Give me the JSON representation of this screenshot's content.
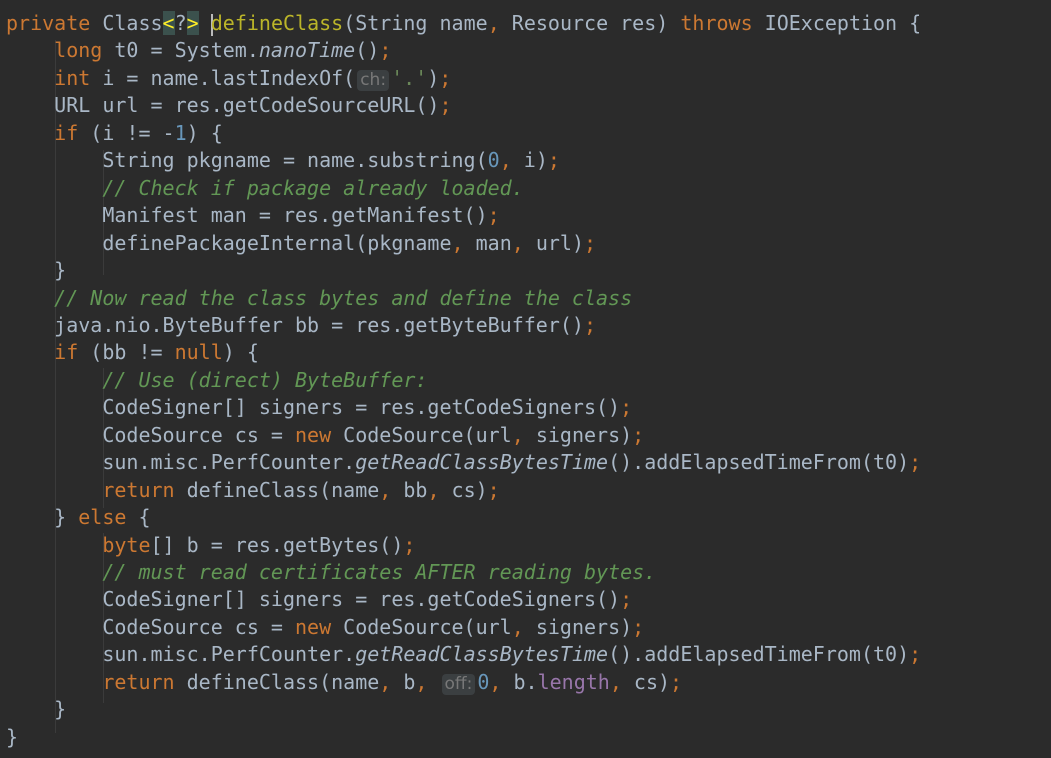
{
  "editor": {
    "language": "java",
    "colors": {
      "background": "#2b2b2b",
      "text": "#a9b7c6",
      "keyword": "#cc7832",
      "comment": "#629755",
      "number": "#6897bb",
      "string": "#6a8759",
      "field": "#9876aa",
      "hint_background": "#3b3f41"
    },
    "lines": [
      {
        "tokens": [
          {
            "t": "private",
            "c": "kw"
          },
          {
            "t": " Class"
          },
          {
            "t": "<",
            "c": "brm"
          },
          {
            "t": "?"
          },
          {
            "t": ">",
            "c": "brm"
          },
          {
            "t": " "
          },
          {
            "caret": true
          },
          {
            "t": "defineClass",
            "c": "ann"
          },
          {
            "t": "(String name"
          },
          {
            "t": ",",
            "c": "kw"
          },
          {
            "t": " Resource res) "
          },
          {
            "t": "throws",
            "c": "kw"
          },
          {
            "t": " IOException {"
          }
        ]
      },
      {
        "tokens": [
          {
            "t": "    "
          },
          {
            "t": "long",
            "c": "kw"
          },
          {
            "t": " t0 = System."
          },
          {
            "t": "nanoTime",
            "c": "it"
          },
          {
            "t": "()"
          },
          {
            "t": ";",
            "c": "kw"
          }
        ]
      },
      {
        "tokens": [
          {
            "t": "    "
          },
          {
            "t": "int",
            "c": "kw"
          },
          {
            "t": " i = name.lastIndexOf("
          },
          {
            "hint": "ch:"
          },
          {
            "t": "'.'",
            "c": "str"
          },
          {
            "t": ")"
          },
          {
            "t": ";",
            "c": "kw"
          }
        ]
      },
      {
        "tokens": [
          {
            "t": "    URL url = res.getCodeSourceURL()"
          },
          {
            "t": ";",
            "c": "kw"
          }
        ]
      },
      {
        "tokens": [
          {
            "t": "    "
          },
          {
            "t": "if",
            "c": "kw"
          },
          {
            "t": " (i != -"
          },
          {
            "t": "1",
            "c": "num"
          },
          {
            "t": ") {"
          }
        ]
      },
      {
        "tokens": [
          {
            "t": "        String pkgname = name.substring("
          },
          {
            "t": "0",
            "c": "num"
          },
          {
            "t": ",",
            "c": "kw"
          },
          {
            "t": " i)"
          },
          {
            "t": ";",
            "c": "kw"
          }
        ]
      },
      {
        "tokens": [
          {
            "t": "        "
          },
          {
            "t": "// Check if package already loaded.",
            "c": "cm"
          }
        ]
      },
      {
        "tokens": [
          {
            "t": "        Manifest man = res.getManifest()"
          },
          {
            "t": ";",
            "c": "kw"
          }
        ]
      },
      {
        "tokens": [
          {
            "t": "        definePackageInternal(pkgname"
          },
          {
            "t": ",",
            "c": "kw"
          },
          {
            "t": " man"
          },
          {
            "t": ",",
            "c": "kw"
          },
          {
            "t": " url)"
          },
          {
            "t": ";",
            "c": "kw"
          }
        ]
      },
      {
        "tokens": [
          {
            "t": "    }"
          }
        ]
      },
      {
        "tokens": [
          {
            "t": "    "
          },
          {
            "t": "// Now read the class bytes and define the class",
            "c": "cm"
          }
        ]
      },
      {
        "tokens": [
          {
            "t": "    java.nio.ByteBuffer bb = res.getByteBuffer()"
          },
          {
            "t": ";",
            "c": "kw"
          }
        ]
      },
      {
        "tokens": [
          {
            "t": "    "
          },
          {
            "t": "if",
            "c": "kw"
          },
          {
            "t": " (bb != "
          },
          {
            "t": "null",
            "c": "kw"
          },
          {
            "t": ") {"
          }
        ]
      },
      {
        "tokens": [
          {
            "t": "        "
          },
          {
            "t": "// Use (direct) ByteBuffer:",
            "c": "cm"
          }
        ]
      },
      {
        "tokens": [
          {
            "t": "        CodeSigner[] signers = res.getCodeSigners()"
          },
          {
            "t": ";",
            "c": "kw"
          }
        ]
      },
      {
        "tokens": [
          {
            "t": "        CodeSource cs = "
          },
          {
            "t": "new",
            "c": "kw"
          },
          {
            "t": " CodeSource(url"
          },
          {
            "t": ",",
            "c": "kw"
          },
          {
            "t": " signers)"
          },
          {
            "t": ";",
            "c": "kw"
          }
        ]
      },
      {
        "tokens": [
          {
            "t": "        sun.misc.PerfCounter."
          },
          {
            "t": "getReadClassBytesTime",
            "c": "it"
          },
          {
            "t": "().addElapsedTimeFrom(t0)"
          },
          {
            "t": ";",
            "c": "kw"
          }
        ]
      },
      {
        "tokens": [
          {
            "t": "        "
          },
          {
            "t": "return",
            "c": "kw"
          },
          {
            "t": " defineClass(name"
          },
          {
            "t": ",",
            "c": "kw"
          },
          {
            "t": " bb"
          },
          {
            "t": ",",
            "c": "kw"
          },
          {
            "t": " cs)"
          },
          {
            "t": ";",
            "c": "kw"
          }
        ]
      },
      {
        "tokens": [
          {
            "t": "    } "
          },
          {
            "t": "else",
            "c": "kw"
          },
          {
            "t": " {"
          }
        ]
      },
      {
        "tokens": [
          {
            "t": "        "
          },
          {
            "t": "byte",
            "c": "kw"
          },
          {
            "t": "[] b = res.getBytes()"
          },
          {
            "t": ";",
            "c": "kw"
          }
        ]
      },
      {
        "tokens": [
          {
            "t": "        "
          },
          {
            "t": "// must read certificates AFTER reading bytes.",
            "c": "cm"
          }
        ]
      },
      {
        "tokens": [
          {
            "t": "        CodeSigner[] signers = res.getCodeSigners()"
          },
          {
            "t": ";",
            "c": "kw"
          }
        ]
      },
      {
        "tokens": [
          {
            "t": "        CodeSource cs = "
          },
          {
            "t": "new",
            "c": "kw"
          },
          {
            "t": " CodeSource(url"
          },
          {
            "t": ",",
            "c": "kw"
          },
          {
            "t": " signers)"
          },
          {
            "t": ";",
            "c": "kw"
          }
        ]
      },
      {
        "tokens": [
          {
            "t": "        sun.misc.PerfCounter."
          },
          {
            "t": "getReadClassBytesTime",
            "c": "it"
          },
          {
            "t": "().addElapsedTimeFrom(t0)"
          },
          {
            "t": ";",
            "c": "kw"
          }
        ]
      },
      {
        "tokens": [
          {
            "t": "        "
          },
          {
            "t": "return",
            "c": "kw"
          },
          {
            "t": " defineClass(name"
          },
          {
            "t": ",",
            "c": "kw"
          },
          {
            "t": " b"
          },
          {
            "t": ",",
            "c": "kw"
          },
          {
            "t": " "
          },
          {
            "hint": "off:"
          },
          {
            "t": "0",
            "c": "num"
          },
          {
            "t": ",",
            "c": "kw"
          },
          {
            "t": " b."
          },
          {
            "t": "length",
            "c": "fld"
          },
          {
            "t": ",",
            "c": "kw"
          },
          {
            "t": " cs)"
          },
          {
            "t": ";",
            "c": "kw"
          }
        ]
      },
      {
        "tokens": [
          {
            "t": "    }"
          }
        ]
      },
      {
        "tokens": [
          {
            "t": "}"
          }
        ]
      }
    ]
  }
}
